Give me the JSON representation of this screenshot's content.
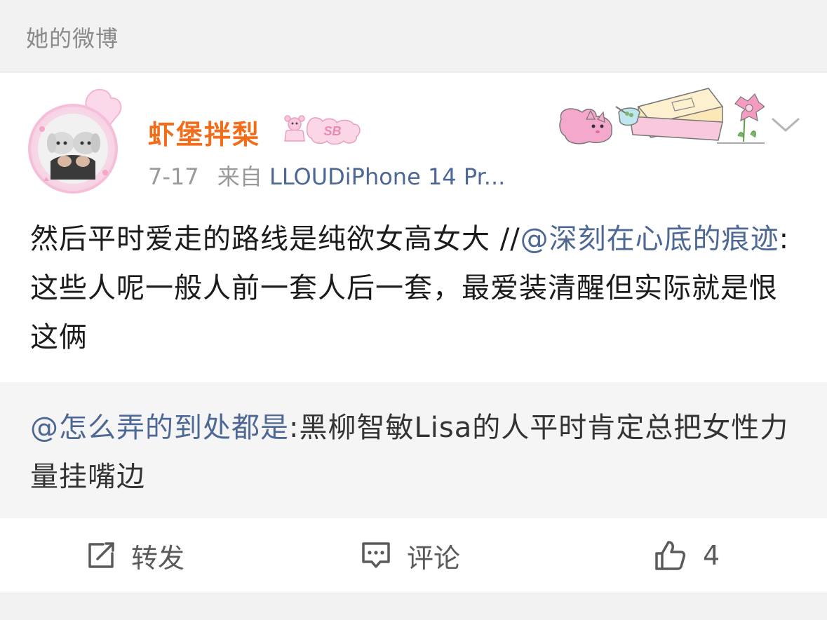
{
  "section": {
    "title": "她的微博"
  },
  "post": {
    "username": "虾堡拌梨",
    "badge_text": "SB",
    "date": "7-17",
    "source_prefix": "来自",
    "source": "LLOUDiPhone 14 Pr...",
    "text_part1": "然后平时爱走的路线是纯欲女高女大 //",
    "mention1": "@深刻在心底的痕迹",
    "text_part2": ":这些人呢一般人前一套人后一套，最爱装清醒但实际就是恨这俩"
  },
  "retweet": {
    "mention": "@怎么弄的到处都是",
    "text": ":黑柳智敏Lisa的人平时肯定总把女性力量挂嘴边"
  },
  "actions": {
    "repost_label": "转发",
    "comment_label": "评论",
    "like_count": "4"
  },
  "colors": {
    "username": "#f26d1a",
    "mention": "#4d6894",
    "muted": "#9a9a9a",
    "background": "#f2f2f2"
  },
  "icons": [
    "avatar",
    "user-badge-icon",
    "card-decoration",
    "chevron-down-icon",
    "repost-icon",
    "comment-icon",
    "thumbs-up-icon"
  ]
}
